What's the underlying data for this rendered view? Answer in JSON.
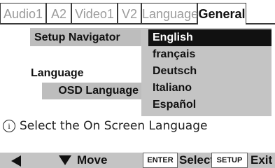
{
  "tabs": [
    {
      "label": "Audio1",
      "active": false
    },
    {
      "label": "A2",
      "active": false
    },
    {
      "label": "Video1",
      "active": false
    },
    {
      "label": "V2",
      "active": false
    },
    {
      "label": "Language",
      "active": false
    },
    {
      "label": "General",
      "active": true
    }
  ],
  "left": {
    "setup_navigator": "Setup Navigator",
    "language": "Language",
    "osd_language": "OSD Language"
  },
  "options": [
    "English",
    "français",
    "Deutsch",
    "Italiano",
    "Español"
  ],
  "selected_option": "English",
  "info": {
    "icon": "info-icon",
    "text": "Select the On Screen Language"
  },
  "footer": {
    "move_label": "Move",
    "enter_key": "ENTER",
    "select_label": "Select",
    "setup_key": "SETUP",
    "exit_label": "Exit"
  },
  "colors": {
    "panel": "#c4c4c4",
    "selected": "#111111"
  }
}
